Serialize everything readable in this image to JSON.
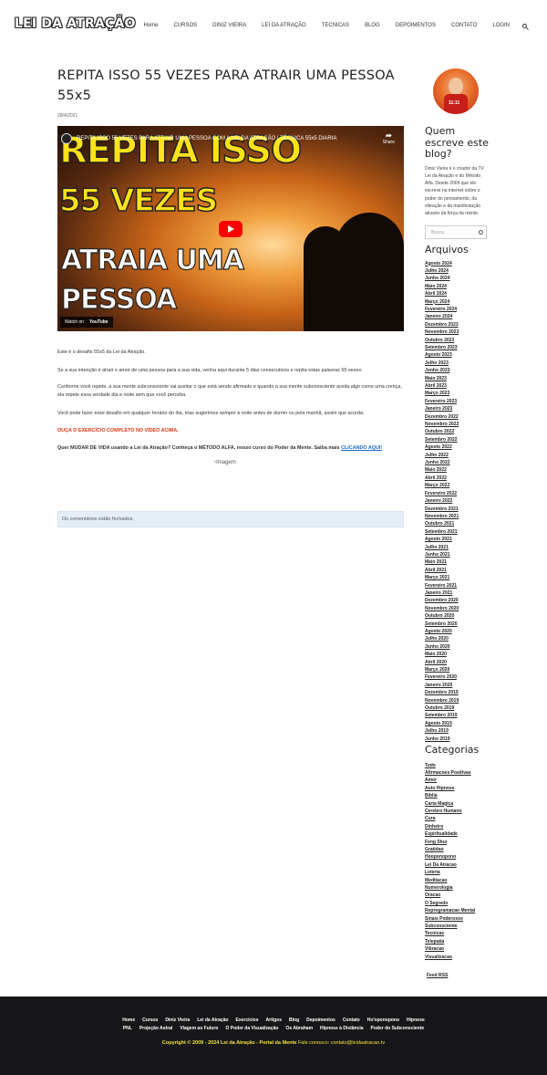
{
  "header": {
    "logo": "LEI DA ATRAÇÃO",
    "nav": [
      "Home",
      "CURSOS",
      "DINIZ VIEIRA",
      "LEI DA ATRAÇÃO",
      "TECNICAS",
      "BLOG",
      "DEPOIMENTOS",
      "CONTATO",
      "LOGIN"
    ]
  },
  "post": {
    "title_line1": "REPITA ISSO 55 VEZES PARA ATRAIR UMA PESSOA",
    "title_line2": "55x5",
    "date": "28/4/2021",
    "video": {
      "title": "REPITA ISSO 55 VEZES PARA ATRAIR UMA PESSOA COM A LEI DA ATRAÇÃO | TÉCNICA 55x5 DIARIA",
      "share": "Share",
      "thumb_line1": "REPITA ISSO",
      "thumb_line2": "55 VEZES",
      "thumb_line3": "ATRAIA UMA",
      "thumb_line4": "PESSOA",
      "watch_on": "Watch on",
      "youtube": "YouTube"
    },
    "p1": "Este é o desafio 55x5 da Lei da Atração.",
    "p2": "Se a sua intenção é atrair o amor de uma pessoa para a sua vida, venha aqui durante 5 dias consecutivos e repita estas palavras 55 vezes:",
    "p3": "Conforme você repete, a sua mente subconsciente vai aceitar o que está sendo afirmado e quando a sua mente subconsciente aceita algo como uma crença, ela repete essa verdade dia e noite sem que você perceba.",
    "p4": "Você pode fazer esse desafio em qualquer horário do dia, mas sugerimos sempre à noite antes de dormir ou pela manhã, assim que acorda.",
    "p5": "OUÇA O EXERCÍCIO COMPLETO NO VÍDEO ACIMA.",
    "p6": "Quer MUDAR DE VIDA usando a Lei da Atração? Conheça o MÉTODO ALFA, nosso curso do Poder da Mente. Saiba mais",
    "p6_link": "CLICANDO AQUI!",
    "image_alt": "Imagem",
    "comments_closed": "Os comentários estão fechados."
  },
  "sidebar": {
    "who_title": "Quem escreve este blog?",
    "about": "Diniz Vieira é o criador da TV Lei da Atração e do Método Alfa. Desde 2009 que ele escreve na internet sobre o poder do pensamento, da vibração e da manifestação através da força da mente.",
    "search_placeholder": "Busca",
    "archives_title": "Arquivos",
    "archives": [
      "Agosto 2024",
      "Julho 2024",
      "Junho 2024",
      "Maio 2024",
      "Abril 2024",
      "Março 2024",
      "Fevereiro 2024",
      "Janeiro 2024",
      "Dezembro 2023",
      "Novembro 2023",
      "Outubro 2023",
      "Setembro 2023",
      "Agosto 2023",
      "Julho 2023",
      "Junho 2023",
      "Maio 2023",
      "Abril 2023",
      "Março 2023",
      "Fevereiro 2023",
      "Janeiro 2023",
      "Dezembro 2022",
      "Novembro 2022",
      "Outubro 2022",
      "Setembro 2022",
      "Agosto 2022",
      "Julho 2022",
      "Junho 2022",
      "Maio 2022",
      "Abril 2022",
      "Março 2022",
      "Fevereiro 2022",
      "Janeiro 2022",
      "Dezembro 2021",
      "Novembro 2021",
      "Outubro 2021",
      "Setembro 2021",
      "Agosto 2021",
      "Julho 2021",
      "Junho 2021",
      "Maio 2021",
      "Abril 2021",
      "Março 2021",
      "Fevereiro 2021",
      "Janeiro 2021",
      "Dezembro 2020",
      "Novembro 2020",
      "Outubro 2020",
      "Setembro 2020",
      "Agosto 2020",
      "Julho 2020",
      "Junho 2020",
      "Maio 2020",
      "Abril 2020",
      "Março 2020",
      "Fevereiro 2020",
      "Janeiro 2020",
      "Dezembro 2019",
      "Novembro 2019",
      "Outubro 2019",
      "Setembro 2019",
      "Agosto 2019",
      "Julho 2019",
      "Junho 2019"
    ],
    "categories_title": "Categorias",
    "categories": [
      "Tudo",
      "Afirmacoes Positivas",
      "Amor",
      "Auto Hipnose",
      "Biblia",
      "Carta Magica",
      "Cerebro Humano",
      "Cura",
      "Dinheiro",
      "Espiritualidade",
      "Feng Shui",
      "Gratidao",
      "Hooponopono",
      "Lei Da Atracao",
      "Loteria",
      "Meditacao",
      "Numerologia",
      "Oracao",
      "O Segredo",
      "Reprogramacao Mental",
      "Sinais Poderosos",
      "Subconsciente",
      "Tecnicas",
      "Telepatia",
      "Vibracao",
      "Visualizacao"
    ],
    "feed": "Feed RSS"
  },
  "footer": {
    "row1": [
      "Home",
      "Cursos",
      "Diniz Vieira",
      "Lei da Atração",
      "Exercícios",
      "Artigos",
      "Blog",
      "Depoimentos",
      "Contato",
      "Ho'oponopono",
      "Hipnose"
    ],
    "row2": [
      "PNL",
      "Projeção Astral",
      "Viagem ao Futuro",
      "O Poder da Visualização",
      "Os Abraham",
      "Hipnose à Distância",
      "Poder do Subconsciente"
    ],
    "copyright": "Copyright © 2009 - 2024 Lei da Atração - Portal da Mente",
    "contact": "Fale conosco: contato@leidaatracao.tv"
  }
}
